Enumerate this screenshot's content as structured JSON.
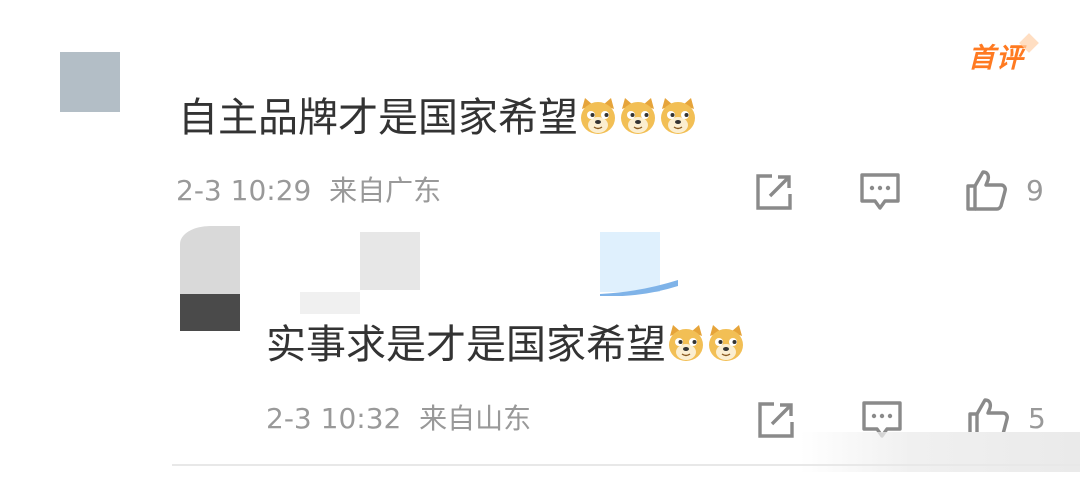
{
  "comment1": {
    "badge": "首评",
    "text": "自主品牌才是国家希望",
    "emoji_count": 3,
    "time": "2-3 10:29",
    "location": "来自广东",
    "likes": "9"
  },
  "comment2": {
    "text": "实事求是才是国家希望",
    "emoji_count": 2,
    "time": "2-3 10:32",
    "location": "来自山东",
    "likes": "5"
  },
  "icons": [
    "share-icon",
    "comment-icon",
    "like-icon",
    "doge-emoji"
  ],
  "colors": {
    "text": "#333333",
    "meta": "#999999",
    "badge": "#ff7a21",
    "icon": "#8a8a8a"
  }
}
